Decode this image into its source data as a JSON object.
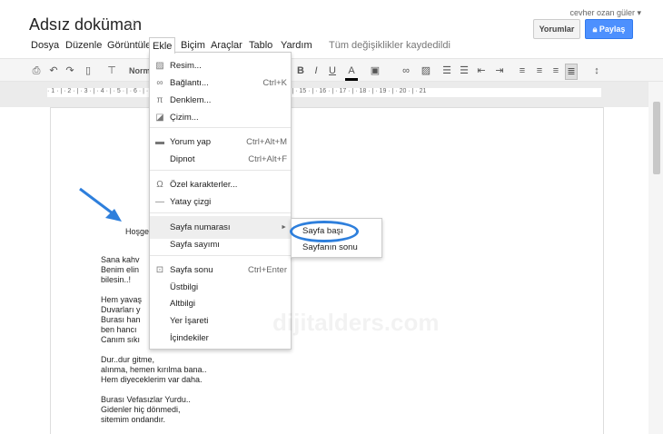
{
  "header": {
    "title": "Adsız doküman",
    "user": "cevher ozan güler ▾",
    "star_icon": "star-icon",
    "save_status": "Tüm değişiklikler kaydedildi",
    "comments_label": "Yorumlar",
    "share_label": "Paylaş"
  },
  "menubar": [
    "Dosya",
    "Düzenle",
    "Görüntüle",
    "Ekle",
    "Biçim",
    "Araçlar",
    "Tablo",
    "Yardım"
  ],
  "toolbar": {
    "style": "Norm",
    "bold": "B",
    "italic": "I",
    "underline": "U",
    "text_color": "A"
  },
  "ruler": "· 1 · | · 2 · | · 3 · | · 4 · | · 5 · | · 6 · | · 7 · | · 8 · | · 9 · | · 10 · | · 11 · | · 12 · | · 13 · | · 14 · | · 15 · | · 16 · | · 17 · | · 18 · | · 19 · | · 20 · | · 21",
  "insert_menu": {
    "items": [
      {
        "label": "Resim...",
        "shortcut": "",
        "icon": "image-icon"
      },
      {
        "label": "Bağlantı...",
        "shortcut": "Ctrl+K",
        "icon": "link-icon"
      },
      {
        "label": "Denklem...",
        "shortcut": "",
        "icon": "pi-icon"
      },
      {
        "label": "Çizim...",
        "shortcut": "",
        "icon": "drawing-icon"
      },
      {
        "label": "Yorum yap",
        "shortcut": "Ctrl+Alt+M",
        "icon": "comment-icon"
      },
      {
        "label": "Dipnot",
        "shortcut": "Ctrl+Alt+F",
        "icon": ""
      },
      {
        "label": "Özel karakterler...",
        "shortcut": "",
        "icon": "omega-icon"
      },
      {
        "label": "Yatay çizgi",
        "shortcut": "",
        "icon": "hr-icon"
      },
      {
        "label": "Sayfa numarası",
        "shortcut": "►",
        "icon": ""
      },
      {
        "label": "Sayfa sayımı",
        "shortcut": "",
        "icon": ""
      },
      {
        "label": "Sayfa sonu",
        "shortcut": "Ctrl+Enter",
        "icon": "page-break-icon"
      },
      {
        "label": "Üstbilgi",
        "shortcut": "",
        "icon": ""
      },
      {
        "label": "Altbilgi",
        "shortcut": "",
        "icon": ""
      },
      {
        "label": "Yer İşareti",
        "shortcut": "",
        "icon": ""
      },
      {
        "label": "İçindekiler",
        "shortcut": "",
        "icon": ""
      }
    ],
    "highlighted": "Sayfa numarası"
  },
  "submenu": [
    "Sayfa başı",
    "Sayfanın sonu"
  ],
  "document": {
    "heading": "Hoşge",
    "lines": [
      "Sana kahv",
      "Benim elin",
      "bilesin..!",
      "",
      "Hem yavaş",
      "Duvarları y",
      "Burası han",
      "ben hancı",
      "Canım sıkı",
      "",
      "Dur..dur gitme,",
      "alınma, hemen kırılma bana..",
      "Hem diyeceklerim var daha.",
      "",
      "Burası Vefasızlar Yurdu..",
      "Gidenler hiç dönmedi,",
      "sitemim ondandır."
    ]
  },
  "watermark": "dijitalders.com",
  "colors": {
    "accent": "#4d90fe",
    "annotation": "#2e7fdc"
  }
}
